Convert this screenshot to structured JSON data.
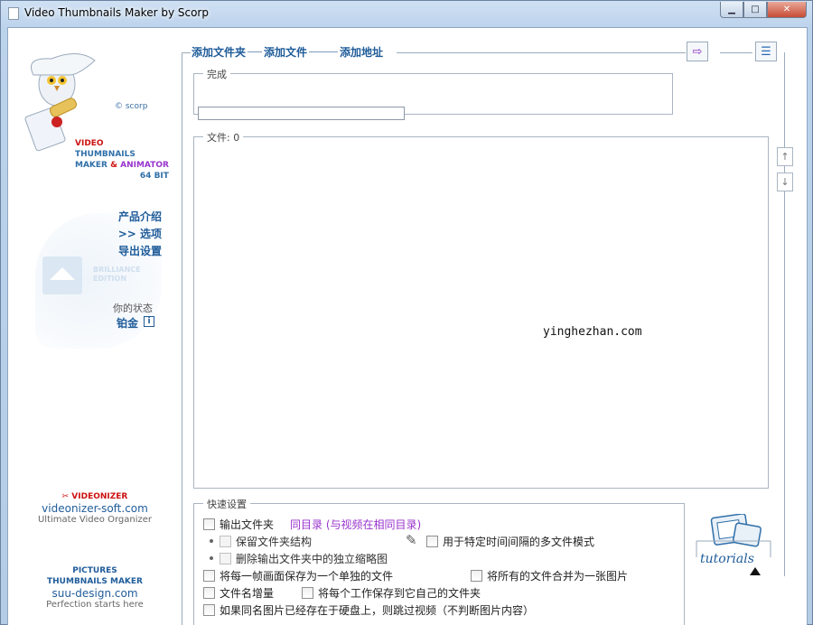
{
  "window": {
    "title": "Video Thumbnails Maker by Scorp",
    "min_glyph": "▁",
    "max_glyph": "□",
    "close_glyph": "✕"
  },
  "sidebar": {
    "scorp": "© scorp",
    "logo": {
      "line1": "VIDEO",
      "line2": "THUMBNAILS",
      "line3a": "MAKER",
      "line3b": "&",
      "line3c": "ANIMATOR",
      "line4": "64 BIT"
    },
    "nav": [
      "产品介绍",
      ">> 选项",
      "导出设置"
    ],
    "brilliance": [
      "BRILLIANCE",
      "EDITION"
    ],
    "status_label": "你的状态",
    "status_value": "铂金",
    "info_glyph": "i",
    "promo1": {
      "title": "VIDEONIZER",
      "url": "videonizer-soft.com",
      "slogan": "Ultimate Video Organizer"
    },
    "promo2": {
      "title1": "PICTURES",
      "title2": "THUMBNAILS MAKER",
      "url": "suu-design.com",
      "slogan": "Perfection starts here"
    }
  },
  "toolbar": {
    "add_folder": "添加文件夹",
    "add_file": "添加文件",
    "add_url": "添加地址",
    "exit_glyph": "⇨",
    "menu_glyph": "☰"
  },
  "done_group": {
    "label": "完成",
    "progress": 0
  },
  "files_group": {
    "label": "文件: 0"
  },
  "watermark": "yinghezhan.com",
  "side_buttons": {
    "up": "↑",
    "down": "↓"
  },
  "quick": {
    "label": "快速设置",
    "output_folder": "输出文件夹",
    "same_dir": "同目录 (与视频在相同目录)",
    "keep_structure": "保留文件夹结构",
    "multi_file_mode": "用于特定时间间隔的多文件模式",
    "delete_thumbs": "删除输出文件夹中的独立缩略图",
    "save_each_frame": "将每一帧画面保存为一个单独的文件",
    "merge_all": "将所有的文件合并为一张图片",
    "filename_increment": "文件名增量",
    "save_each_job": "将每个工作保存到它自己的文件夹",
    "skip_existing": "如果同名图片已经存在于硬盘上，则跳过视频（不判断图片内容）",
    "pen_glyph": "✎"
  },
  "tutorials": "tutorials"
}
